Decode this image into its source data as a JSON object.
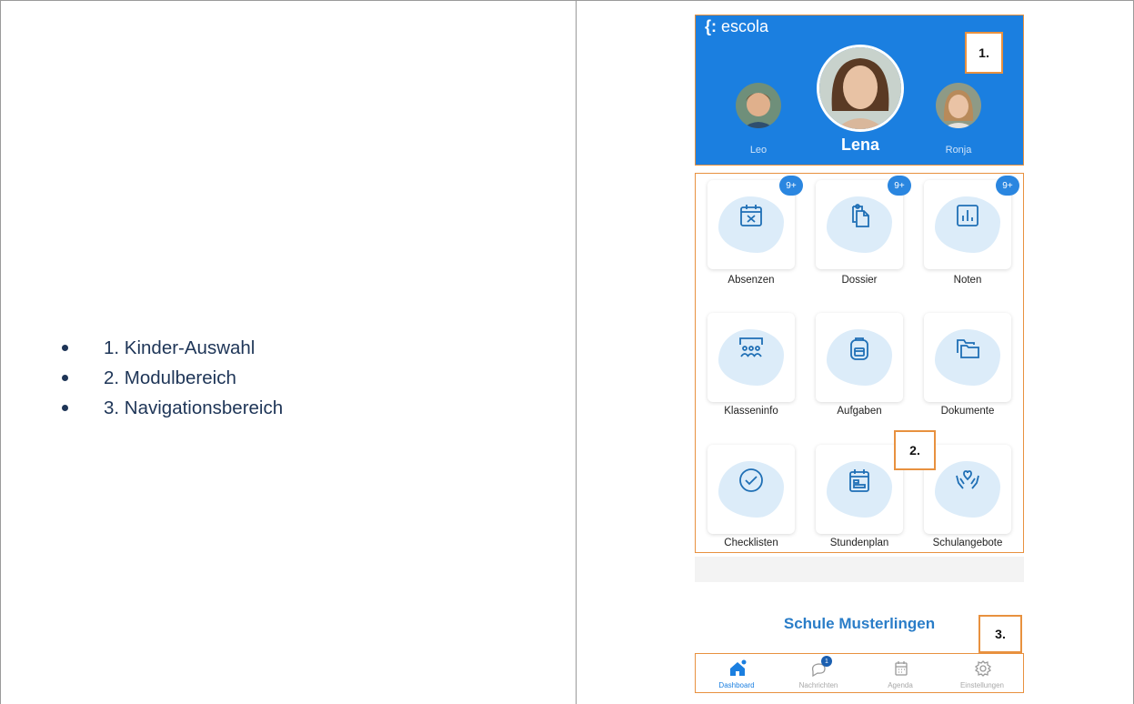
{
  "legend": {
    "items": [
      "1. Kinder-Auswahl",
      "2. Modulbereich",
      "3. Navigationsbereich"
    ]
  },
  "app": {
    "logo_text": "escola",
    "children": [
      {
        "name": "Leo",
        "selected": false
      },
      {
        "name": "Lena",
        "selected": true
      },
      {
        "name": "Ronja",
        "selected": false
      }
    ],
    "modules": [
      {
        "label": "Absenzen",
        "badge": "9+",
        "icon": "calendar-x-icon"
      },
      {
        "label": "Dossier",
        "badge": "9+",
        "icon": "documents-copy-icon"
      },
      {
        "label": "Noten",
        "badge": "9+",
        "icon": "bar-chart-icon"
      },
      {
        "label": "Klasseninfo",
        "badge": "",
        "icon": "classroom-icon"
      },
      {
        "label": "Aufgaben",
        "badge": "",
        "icon": "backpack-icon"
      },
      {
        "label": "Dokumente",
        "badge": "",
        "icon": "folder-icon"
      },
      {
        "label": "Checklisten",
        "badge": "",
        "icon": "check-circle-icon"
      },
      {
        "label": "Stundenplan",
        "badge": "",
        "icon": "timetable-icon"
      },
      {
        "label": "Schulangebote",
        "badge": "",
        "icon": "hands-heart-icon"
      }
    ],
    "school_name": "Schule Musterlingen",
    "nav": [
      {
        "label": "Dashboard",
        "icon": "home-icon",
        "active": true
      },
      {
        "label": "Nachrichten",
        "icon": "chat-bubble-icon",
        "active": false,
        "badge": "1"
      },
      {
        "label": "Agenda",
        "icon": "calendar-icon",
        "active": false
      },
      {
        "label": "Einstellungen",
        "icon": "gear-icon",
        "active": false
      }
    ]
  },
  "callouts": {
    "one": "1.",
    "two": "2.",
    "three": "3."
  },
  "colors": {
    "accent_blue": "#1b7fe0",
    "callout_orange": "#e8913f",
    "text_navy": "#1e3557"
  }
}
